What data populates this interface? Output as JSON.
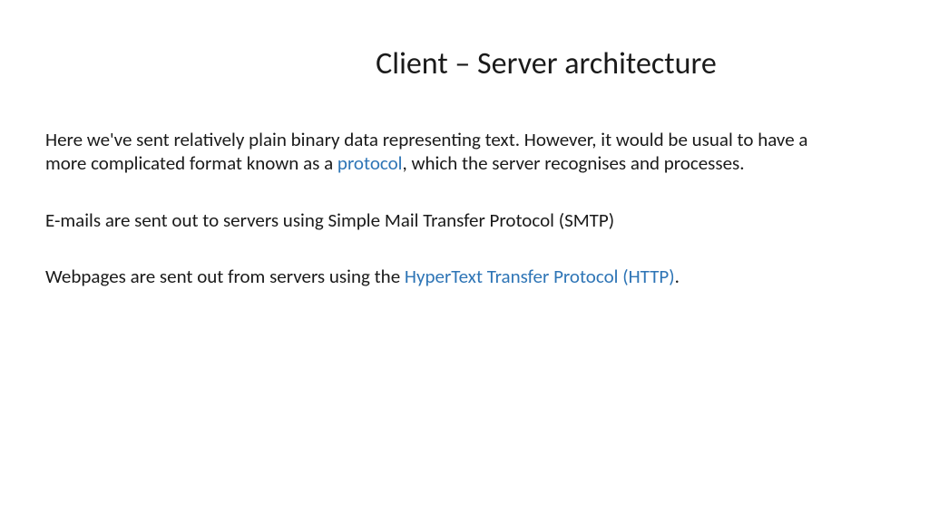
{
  "title": "Client – Server architecture",
  "para1": {
    "part1": "Here we've sent relatively plain binary data representing text. However, it would be usual to have a more complicated format known as a ",
    "link": "protocol",
    "part2": ", which the server recognises and processes."
  },
  "para2": "E-mails are sent out to servers using Simple Mail Transfer Protocol (SMTP)",
  "para3": {
    "part1": "Webpages are sent out from servers using the ",
    "link": "HyperText Transfer Protocol (HTTP)",
    "part2": "."
  }
}
